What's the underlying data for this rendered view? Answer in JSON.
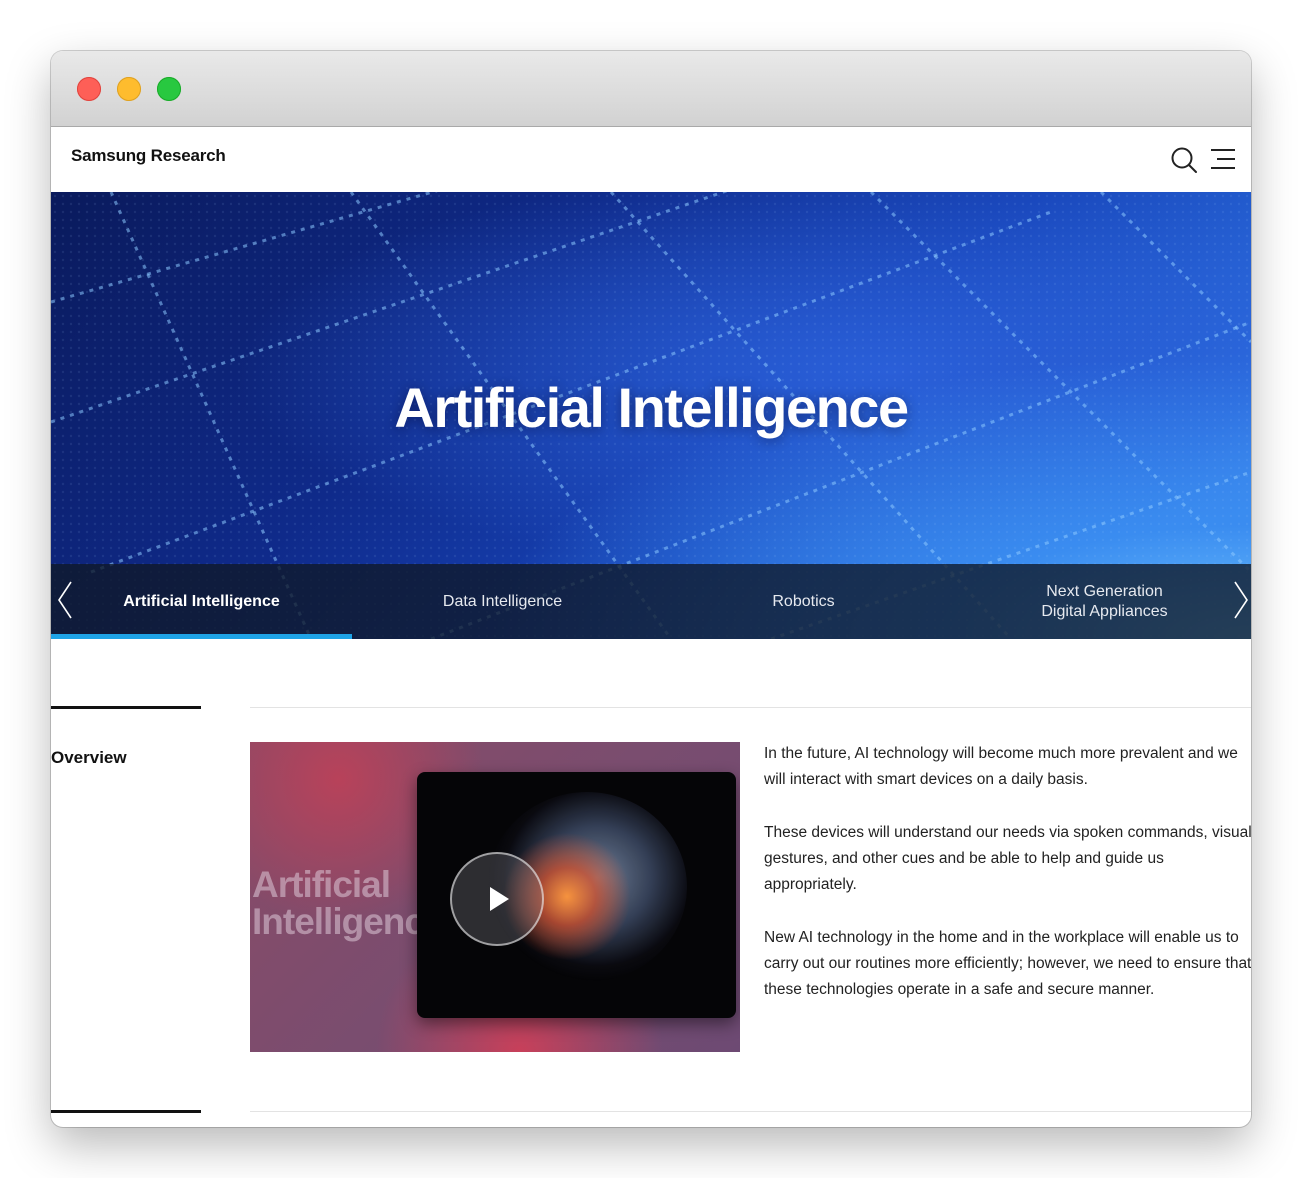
{
  "header": {
    "logo": "Samsung Research",
    "search_icon": "search-icon",
    "menu_icon": "menu-icon"
  },
  "hero": {
    "title": "Artificial Intelligence"
  },
  "tabs": [
    {
      "label": "Artificial Intelligence",
      "active": true
    },
    {
      "label": "Data Intelligence",
      "active": false
    },
    {
      "label": "Robotics",
      "active": false
    },
    {
      "label_line1": "Next Generation",
      "label_line2": "Digital Appliances",
      "active": false
    }
  ],
  "nav_arrows": {
    "prev_icon": "chevron-left-icon",
    "next_icon": "chevron-right-icon"
  },
  "section": {
    "label": "Overview",
    "video": {
      "thumbnail_text_line1": "Artificial",
      "thumbnail_text_line2": "Intelligence",
      "play_icon": "play-icon"
    },
    "paragraphs": [
      "In the future, AI technology will become much more prevalent and we will interact with smart devices on a daily basis.",
      "These devices will understand our needs via spoken commands, visual gestures, and other cues and be able to help and guide us appropriately.",
      "New AI technology in the home and in the workplace will enable us to carry out our routines more efficiently; however, we need to ensure that these technologies operate in a safe and secure manner."
    ]
  },
  "colors": {
    "accent": "#1ea3e6",
    "tab_bar_bg": "#101828",
    "hero_dark": "#0a1a5c",
    "hero_light": "#58b0ff"
  }
}
